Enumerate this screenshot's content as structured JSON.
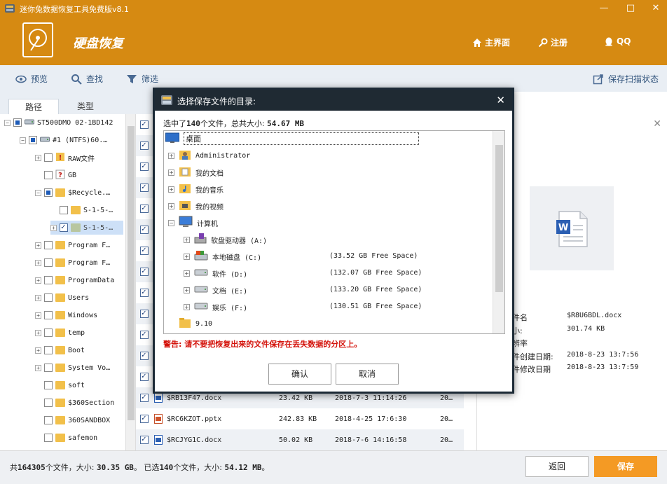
{
  "window": {
    "title": "迷你兔数据恢复工具免费版v8.1",
    "app_name": "硬盘恢复",
    "nav": {
      "home": "主界面",
      "register": "注册",
      "qq": "QQ"
    },
    "controls": {
      "minimize": "—",
      "maximize": "□",
      "close": "✕"
    }
  },
  "toolbar": {
    "preview": "预览",
    "find": "查找",
    "filter": "筛选",
    "save_scan": "保存扫描状态"
  },
  "tabs": [
    "路径",
    "类型"
  ],
  "tree": [
    {
      "label": "ST500DMO 02-1BD142",
      "level": 0,
      "check": "partial",
      "expander": "−",
      "icon": "drive"
    },
    {
      "label": "#1 (NTFS)60.…",
      "level": 1,
      "check": "partial",
      "expander": "−",
      "icon": "partition"
    },
    {
      "label": "RAW文件",
      "level": 2,
      "check": "none",
      "expander": "+",
      "icon": "raw"
    },
    {
      "label": "GB",
      "level": 2,
      "check": "none",
      "expander": "",
      "icon": "unknown"
    },
    {
      "label": "$Recycle.…",
      "level": 2,
      "check": "partial",
      "expander": "−",
      "icon": "folder"
    },
    {
      "label": "S-1-5-…",
      "level": 3,
      "check": "none",
      "expander": "",
      "icon": "folder"
    },
    {
      "label": "S-1-5-…",
      "level": 3,
      "check": "checked",
      "expander": "+",
      "icon": "folder",
      "selected": true
    },
    {
      "label": "Program F…",
      "level": 2,
      "check": "none",
      "expander": "+",
      "icon": "folder"
    },
    {
      "label": "Program F…",
      "level": 2,
      "check": "none",
      "expander": "+",
      "icon": "folder"
    },
    {
      "label": "ProgramData",
      "level": 2,
      "check": "none",
      "expander": "+",
      "icon": "folder"
    },
    {
      "label": "Users",
      "level": 2,
      "check": "none",
      "expander": "+",
      "icon": "folder"
    },
    {
      "label": "Windows",
      "level": 2,
      "check": "none",
      "expander": "+",
      "icon": "folder"
    },
    {
      "label": "temp",
      "level": 2,
      "check": "none",
      "expander": "+",
      "icon": "folder"
    },
    {
      "label": "Boot",
      "level": 2,
      "check": "none",
      "expander": "+",
      "icon": "folder"
    },
    {
      "label": "System Vo…",
      "level": 2,
      "check": "none",
      "expander": "+",
      "icon": "folder"
    },
    {
      "label": "soft",
      "level": 2,
      "check": "none",
      "expander": "",
      "icon": "folder"
    },
    {
      "label": "$360Section",
      "level": 2,
      "check": "none",
      "expander": "",
      "icon": "folder"
    },
    {
      "label": "360SANDBOX",
      "level": 2,
      "check": "none",
      "expander": "",
      "icon": "folder"
    },
    {
      "label": "safemon",
      "level": 2,
      "check": "none",
      "expander": "",
      "icon": "folder"
    }
  ],
  "files": [
    {
      "name": "$RB13F47.docx",
      "size": "23.42 KB",
      "date": "2018-7-3 11:14:26",
      "more": "20…",
      "type": "doc"
    },
    {
      "name": "$RC6KZOT.pptx",
      "size": "242.83 KB",
      "date": "2018-4-25 17:6:30",
      "more": "20…",
      "type": "ppt"
    },
    {
      "name": "$RCJYG1C.docx",
      "size": "50.02 KB",
      "date": "2018-7-6 14:16:58",
      "more": "20…",
      "type": "doc"
    }
  ],
  "preview": {
    "close": "✕",
    "properties": [
      {
        "label": "件名",
        "value": "$R8U6BDL.docx"
      },
      {
        "label": "小:",
        "value": "301.74 KB"
      },
      {
        "label": "辨率",
        "value": ""
      },
      {
        "label": "件创建日期:",
        "value": "2018-8-23 13:7:56"
      },
      {
        "label": "件修改日期",
        "value": "2018-8-23 13:7:59"
      }
    ]
  },
  "status": {
    "total_prefix": "共",
    "total_count": "164305",
    "total_mid": "个文件，大小: ",
    "total_size": "30.35 GB",
    "selected_prefix": "。 已选",
    "selected_count": "140",
    "selected_mid": "个文件，大小: ",
    "selected_size": "54.12 MB",
    "selected_suffix": "。",
    "back_button": "返回",
    "save_button": "保存"
  },
  "dialog": {
    "title": "选择保存文件的目录:",
    "close": "✕",
    "summary_prefix": "选中了",
    "summary_count": "140",
    "summary_mid": "个文件，总共大小: ",
    "summary_size": "54.67 MB",
    "tree": [
      {
        "label": "桌面",
        "icon": "desktop",
        "level": 0,
        "expander": "",
        "free": "",
        "selected": true
      },
      {
        "label": "Administrator",
        "icon": "user",
        "level": 1,
        "expander": "+",
        "free": ""
      },
      {
        "label": "我的文档",
        "icon": "docs",
        "level": 1,
        "expander": "+",
        "free": ""
      },
      {
        "label": "我的音乐",
        "icon": "music",
        "level": 1,
        "expander": "+",
        "free": ""
      },
      {
        "label": "我的视频",
        "icon": "video",
        "level": 1,
        "expander": "+",
        "free": ""
      },
      {
        "label": "计算机",
        "icon": "computer",
        "level": 1,
        "expander": "−",
        "free": ""
      },
      {
        "label": "软盘驱动器 (A:)",
        "icon": "floppy",
        "level": 2,
        "expander": "+",
        "free": ""
      },
      {
        "label": "本地磁盘 (C:)",
        "icon": "sysdisk",
        "level": 2,
        "expander": "+",
        "free": "(33.52 GB Free Space)"
      },
      {
        "label": "软件 (D:)",
        "icon": "disk",
        "level": 2,
        "expander": "+",
        "free": "(132.07 GB Free Space)"
      },
      {
        "label": "文档 (E:)",
        "icon": "disk",
        "level": 2,
        "expander": "+",
        "free": "(133.20 GB Free Space)"
      },
      {
        "label": "娱乐 (F:)",
        "icon": "disk",
        "level": 2,
        "expander": "+",
        "free": "(130.51 GB Free Space)"
      },
      {
        "label": "9.10",
        "icon": "folder",
        "level": 1,
        "expander": "",
        "free": ""
      }
    ],
    "warning": "警告: 请不要把恢复出来的文件保存在丢失数据的分区上。",
    "ok": "确认",
    "cancel": "取消"
  },
  "colors": {
    "header": "#d68a12",
    "toolbar": "#e9eef4",
    "save_button": "#f49a24",
    "dialog_title": "#1f2a33",
    "warning": "#d4120a"
  }
}
